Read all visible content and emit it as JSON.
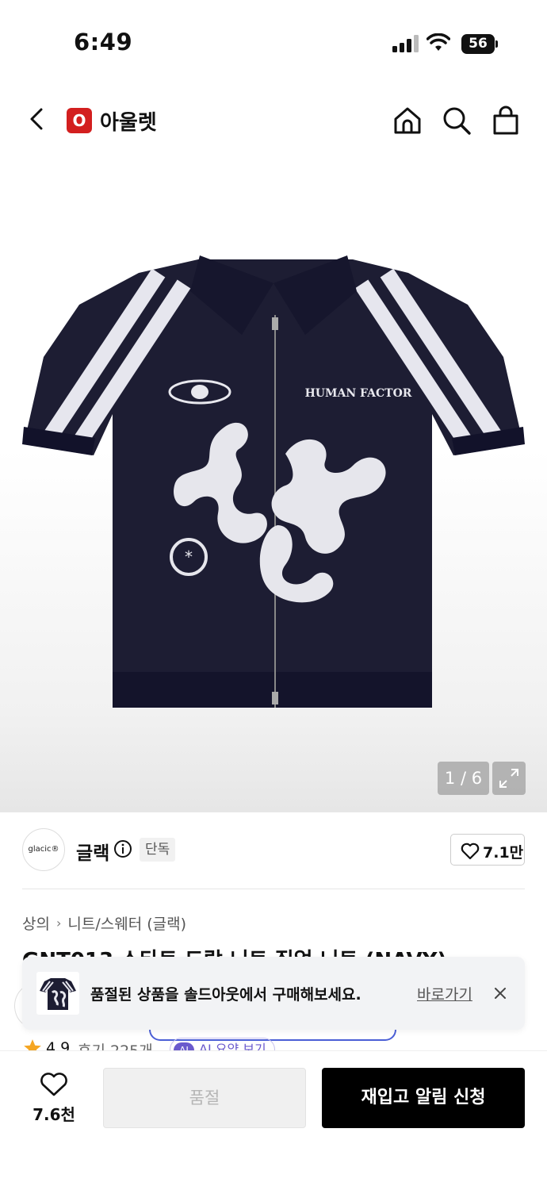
{
  "status_bar": {
    "time": "6:49",
    "battery": "56"
  },
  "header": {
    "brand_logo_letter": "O",
    "title": "아울렛"
  },
  "gallery": {
    "counter": "1 / 6",
    "product_graphic_text": "HUMAN FACTOR"
  },
  "brand": {
    "logo_text": "glacic®",
    "name": "글랙",
    "exclusive_badge": "단독",
    "likes": "7.1만"
  },
  "breadcrumb": {
    "items": [
      "상의",
      "니트/스웨터 (글랙)"
    ]
  },
  "product": {
    "title": "GNT013 스타트 드랍 니트 집업 니트 (NAVY)"
  },
  "rating": {
    "score": "4.9",
    "reviews": "후기 225개",
    "ai_badge": "AI",
    "ai_label": "AI 요약 보기"
  },
  "toast": {
    "message": "품절된 상품을 솔드아웃에서 구매해보세요.",
    "link": "바로가기"
  },
  "bottom_bar": {
    "wish_count": "7.6천",
    "soldout_label": "품절",
    "restock_label": "재입고 알림 신청"
  },
  "colors": {
    "brand_red": "#d31f1f",
    "primary_black": "#000000",
    "navy": "#1d1d33",
    "ai_purple": "#6a5acd"
  }
}
